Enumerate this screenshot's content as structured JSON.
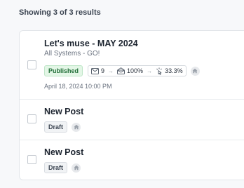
{
  "results": {
    "text": "Showing 3 of 3 results"
  },
  "posts": [
    {
      "title": "Let's muse - MAY 2024",
      "excerpt": "All Systems - GO!",
      "status": "Published",
      "stats": {
        "sent": "9",
        "opened": "100%",
        "clicked": "33.3%"
      },
      "date": "April 18, 2024 10:00 PM",
      "icons": [
        "envelope-icon",
        "envelope-open-icon",
        "click-icon",
        "home-icon"
      ]
    },
    {
      "title": "New Post",
      "status": "Draft",
      "icons": [
        "home-icon"
      ]
    },
    {
      "title": "New Post",
      "status": "Draft",
      "icons": [
        "home-icon"
      ]
    }
  ],
  "colors": {
    "published_bg": "#e3f6e6",
    "published_text": "#23703a",
    "draft_bg": "#f1f3f5"
  }
}
